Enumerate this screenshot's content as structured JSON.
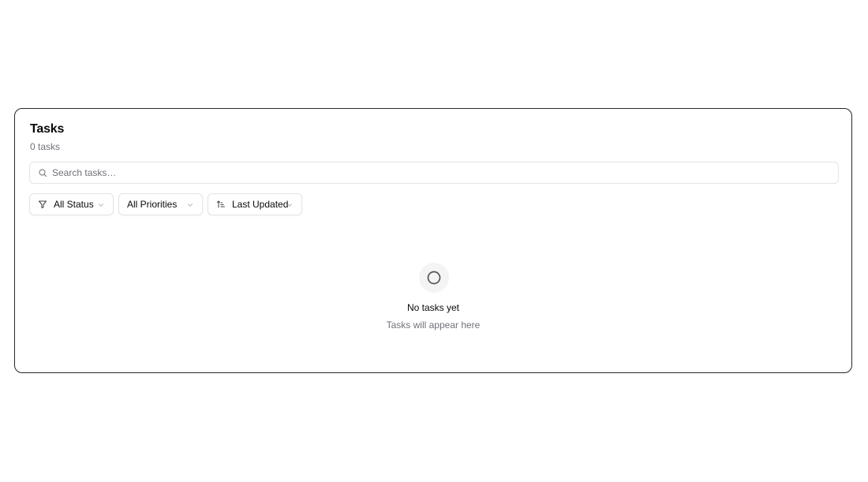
{
  "panel": {
    "title": "Tasks",
    "count_label": "0 tasks"
  },
  "search": {
    "placeholder": "Search tasks…",
    "value": "",
    "icon": "search-icon"
  },
  "filters": {
    "status": {
      "label": "All Status",
      "icon": "filter-icon"
    },
    "priority": {
      "label": "All Priorities"
    },
    "sort": {
      "label": "Last Updated",
      "icon": "sort-ascending-icon"
    }
  },
  "empty_state": {
    "icon": "circle-icon",
    "title": "No tasks yet",
    "subtitle": "Tasks will appear here"
  },
  "colors": {
    "border": "#27272a",
    "muted_text": "#71717a",
    "input_border": "#e4e4e7",
    "icon_bg": "#f4f4f5"
  }
}
